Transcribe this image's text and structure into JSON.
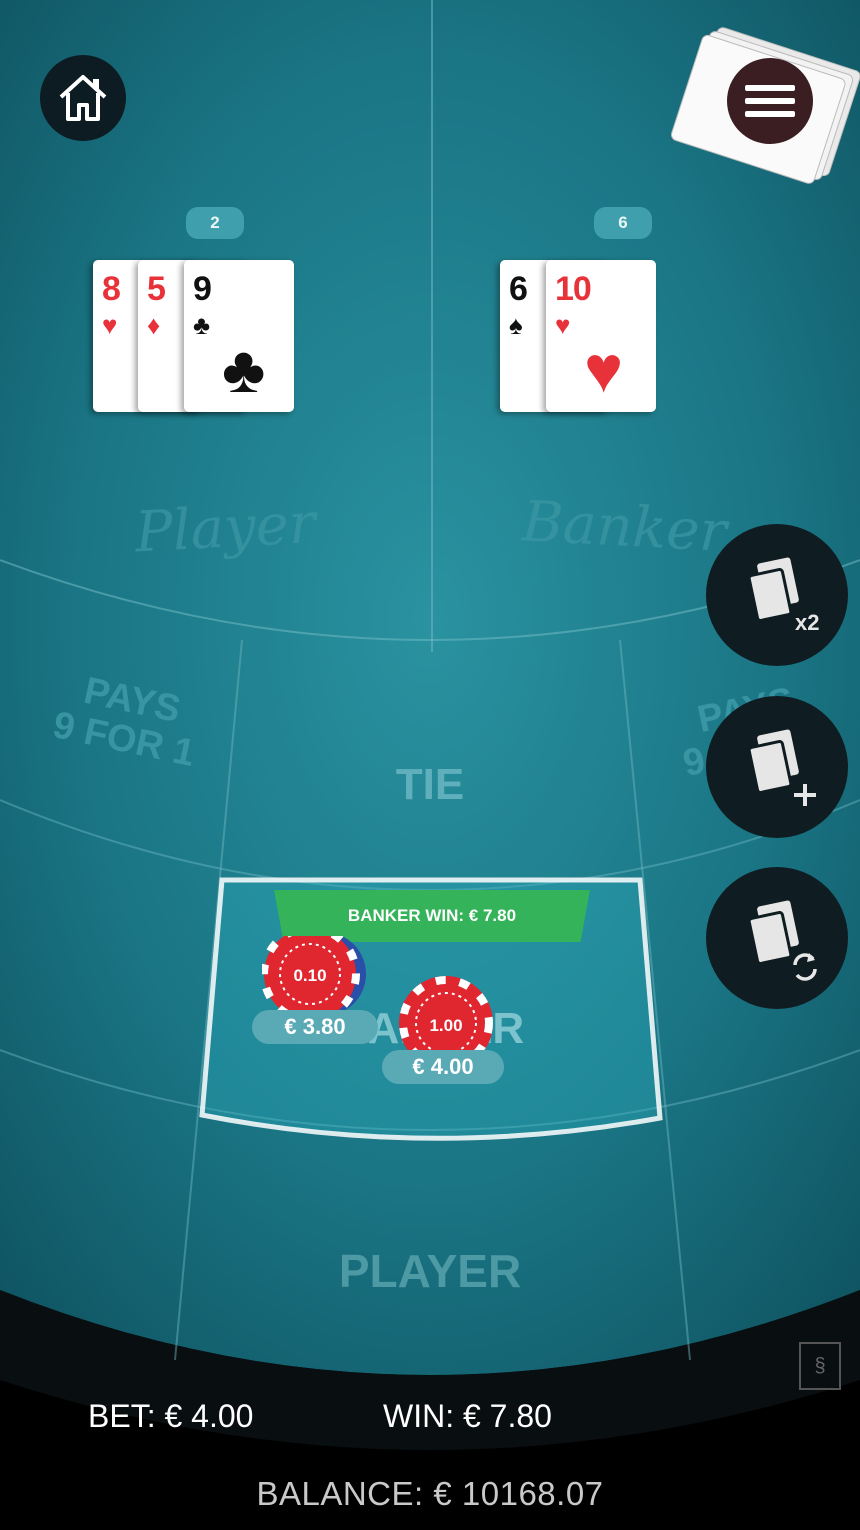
{
  "table": {
    "player_script": "Player",
    "banker_script": "Banker",
    "pays_left_line1": "PAYS",
    "pays_left_line2": "9 FOR 1",
    "pays_right_line1": "PAYS",
    "pays_right_line2": "9 FOR 1",
    "tie_label": "TIE",
    "banker_label": "BANKER",
    "player_label": "PLAYER"
  },
  "player_hand": {
    "score": "2",
    "cards": [
      {
        "rank": "8",
        "suit": "♥",
        "color": "red"
      },
      {
        "rank": "5",
        "suit": "♦",
        "color": "red"
      },
      {
        "rank": "9",
        "suit": "♣",
        "color": "black"
      }
    ]
  },
  "banker_hand": {
    "score": "6",
    "cards": [
      {
        "rank": "6",
        "suit": "♠",
        "color": "black"
      },
      {
        "rank": "10",
        "suit": "♥",
        "color": "red"
      }
    ]
  },
  "result": {
    "banner": "BANKER WIN: € 7.80"
  },
  "chips": {
    "chip_small_value": "0.10",
    "chip_large_value": "1.00",
    "win_stack_label": "€ 3.80",
    "bet_stack_label": "€ 4.00",
    "chip_color": "#e0262f"
  },
  "side_buttons": {
    "double_badge": "x2"
  },
  "footer": {
    "bet": "BET: € 4.00",
    "win": "WIN: € 7.80",
    "balance": "BALANCE: € 10168.07"
  },
  "icons": {
    "home": "home-icon",
    "menu": "menu-icon",
    "double": "cards-double-icon",
    "add": "cards-add-icon",
    "rebet": "cards-rebet-icon"
  },
  "colors": {
    "felt": "#1e7e8d",
    "felt_dark": "#0d4f5c",
    "win_green": "#35b35a",
    "badge": "#3f9fac"
  }
}
